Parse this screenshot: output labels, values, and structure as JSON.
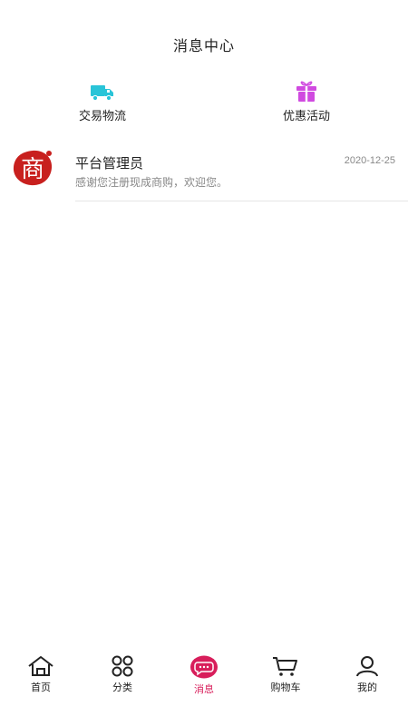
{
  "header": {
    "title": "消息中心"
  },
  "categories": [
    {
      "label": "交易物流",
      "icon": "truck-icon",
      "color": "#29c4d8"
    },
    {
      "label": "优惠活动",
      "icon": "gift-icon",
      "color": "#d04ae0"
    }
  ],
  "messages": [
    {
      "avatar_text": "商",
      "avatar_color": "#c8201e",
      "title": "平台管理员",
      "date": "2020-12-25",
      "preview": "感谢您注册现成商购，欢迎您。"
    }
  ],
  "tabbar": {
    "accent": "#d81e5b",
    "active": "消息",
    "items": [
      {
        "label": "首页",
        "icon": "home-icon"
      },
      {
        "label": "分类",
        "icon": "grid-icon"
      },
      {
        "label": "消息",
        "icon": "message-icon"
      },
      {
        "label": "购物车",
        "icon": "cart-icon"
      },
      {
        "label": "我的",
        "icon": "user-icon"
      }
    ]
  }
}
